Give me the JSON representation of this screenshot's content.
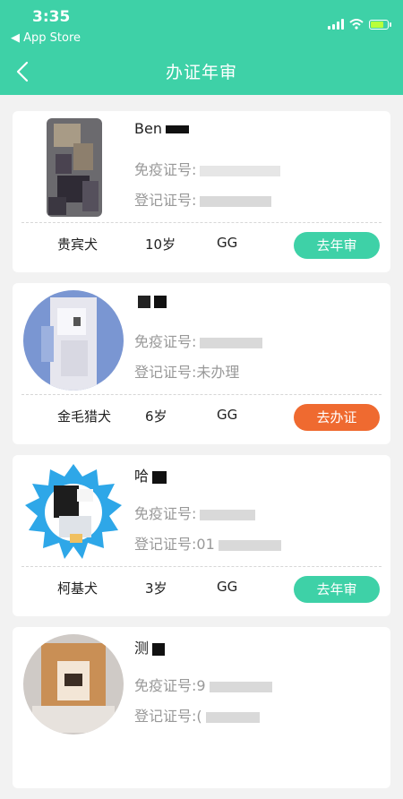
{
  "status_bar": {
    "time": "3:35",
    "back_app": "◀ App Store"
  },
  "header": {
    "title": "办证年审"
  },
  "theme": {
    "accent": "#3ed1a7",
    "orange": "#ef6a30"
  },
  "cards": [
    {
      "name": "Ben",
      "vaccine": "免疫证号:",
      "registration": "登记证号:",
      "breed": "贵宾犬",
      "age": "10岁",
      "gender": "GG",
      "action": "去年审",
      "action_color": "green"
    },
    {
      "name": "",
      "vaccine": "免疫证号:",
      "registration": "登记证号:未办理",
      "breed": "金毛猎犬",
      "age": "6岁",
      "gender": "GG",
      "action": "去办证",
      "action_color": "orange"
    },
    {
      "name": "哈",
      "vaccine": "免疫证号:",
      "registration": "登记证号:01",
      "breed": "柯基犬",
      "age": "3岁",
      "gender": "GG",
      "action": "去年审",
      "action_color": "green"
    },
    {
      "name": "测",
      "vaccine": "免疫证号:9",
      "registration": "登记证号:(",
      "breed": "",
      "age": "",
      "gender": "",
      "action": "",
      "action_color": "green"
    }
  ]
}
